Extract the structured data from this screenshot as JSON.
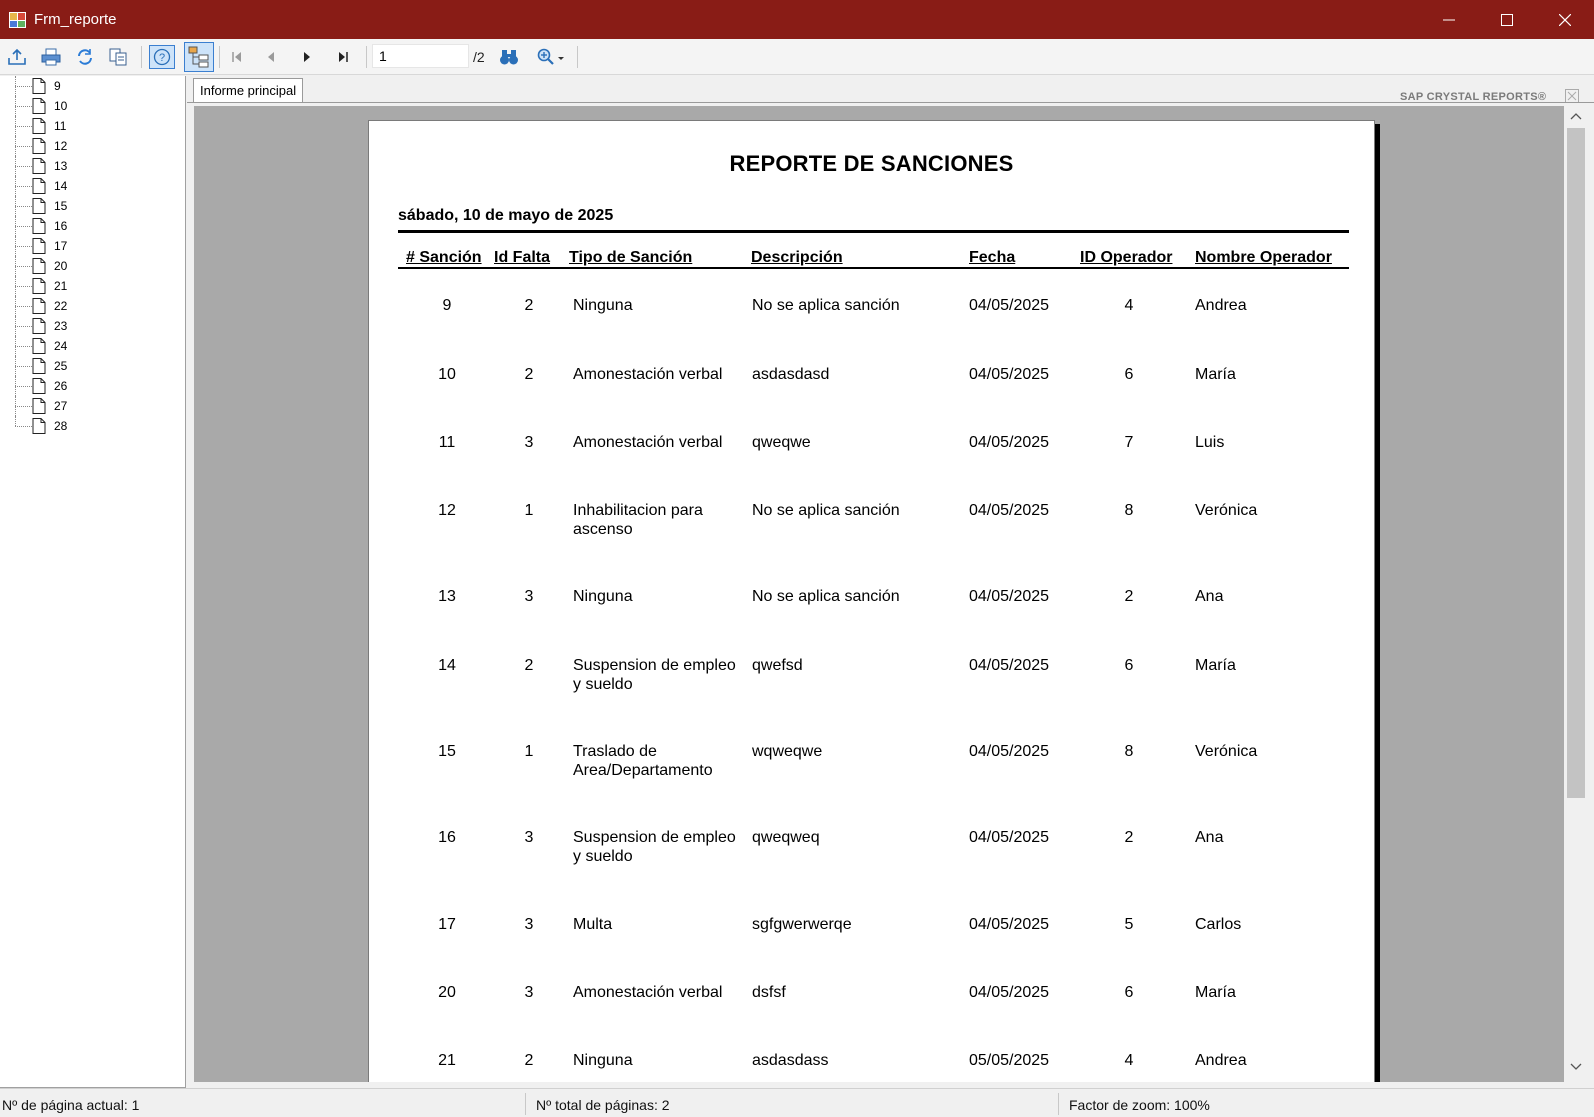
{
  "window": {
    "title": "Frm_reporte"
  },
  "toolbar": {
    "page_value": "1",
    "page_total": "/2",
    "brand": "SAP CRYSTAL REPORTS®"
  },
  "tree": {
    "items": [
      "9",
      "10",
      "11",
      "12",
      "13",
      "14",
      "15",
      "16",
      "17",
      "20",
      "21",
      "22",
      "23",
      "24",
      "25",
      "26",
      "27",
      "28"
    ]
  },
  "tabs": {
    "main": "Informe principal"
  },
  "report": {
    "title": "REPORTE DE SANCIONES",
    "date": "sábado, 10 de mayo de 2025",
    "headers": [
      "# Sanción",
      "Id Falta",
      "Tipo de Sanción",
      "Descripción",
      "Fecha",
      "ID Operador",
      "Nombre Operador"
    ],
    "rows": [
      {
        "id": "9",
        "falta": "2",
        "tipo": "Ninguna",
        "tipo2": "",
        "desc": "No se aplica sanción",
        "fecha": "04/05/2025",
        "op": "4",
        "nombre": "Andrea"
      },
      {
        "id": "10",
        "falta": "2",
        "tipo": "Amonestación verbal",
        "tipo2": "",
        "desc": "asdasdasd",
        "fecha": "04/05/2025",
        "op": "6",
        "nombre": "María"
      },
      {
        "id": "11",
        "falta": "3",
        "tipo": "Amonestación verbal",
        "tipo2": "",
        "desc": "qweqwe",
        "fecha": "04/05/2025",
        "op": "7",
        "nombre": "Luis"
      },
      {
        "id": "12",
        "falta": "1",
        "tipo": "Inhabilitacion para",
        "tipo2": "ascenso",
        "desc": "No se aplica sanción",
        "fecha": "04/05/2025",
        "op": "8",
        "nombre": "Verónica"
      },
      {
        "id": "13",
        "falta": "3",
        "tipo": "Ninguna",
        "tipo2": "",
        "desc": "No se aplica sanción",
        "fecha": "04/05/2025",
        "op": "2",
        "nombre": "Ana"
      },
      {
        "id": "14",
        "falta": "2",
        "tipo": "Suspension de empleo",
        "tipo2": "y sueldo",
        "desc": "qwefsd",
        "fecha": "04/05/2025",
        "op": "6",
        "nombre": "María"
      },
      {
        "id": "15",
        "falta": "1",
        "tipo": "Traslado de",
        "tipo2": "Area/Departamento",
        "desc": "wqweqwe",
        "fecha": "04/05/2025",
        "op": "8",
        "nombre": "Verónica"
      },
      {
        "id": "16",
        "falta": "3",
        "tipo": "Suspension de empleo",
        "tipo2": "y sueldo",
        "desc": "qweqweq",
        "fecha": "04/05/2025",
        "op": "2",
        "nombre": "Ana"
      },
      {
        "id": "17",
        "falta": "3",
        "tipo": "Multa",
        "tipo2": "",
        "desc": "sgfgwerwerqe",
        "fecha": "04/05/2025",
        "op": "5",
        "nombre": "Carlos"
      },
      {
        "id": "20",
        "falta": "3",
        "tipo": "Amonestación verbal",
        "tipo2": "",
        "desc": "dsfsf",
        "fecha": "04/05/2025",
        "op": "6",
        "nombre": "María"
      },
      {
        "id": "21",
        "falta": "2",
        "tipo": "Ninguna",
        "tipo2": "",
        "desc": "asdasdass",
        "fecha": "05/05/2025",
        "op": "4",
        "nombre": "Andrea"
      }
    ]
  },
  "status": {
    "current_page": "Nº de página actual: 1",
    "total_pages": "Nº total de páginas: 2",
    "zoom": "Factor de zoom: 100%"
  }
}
